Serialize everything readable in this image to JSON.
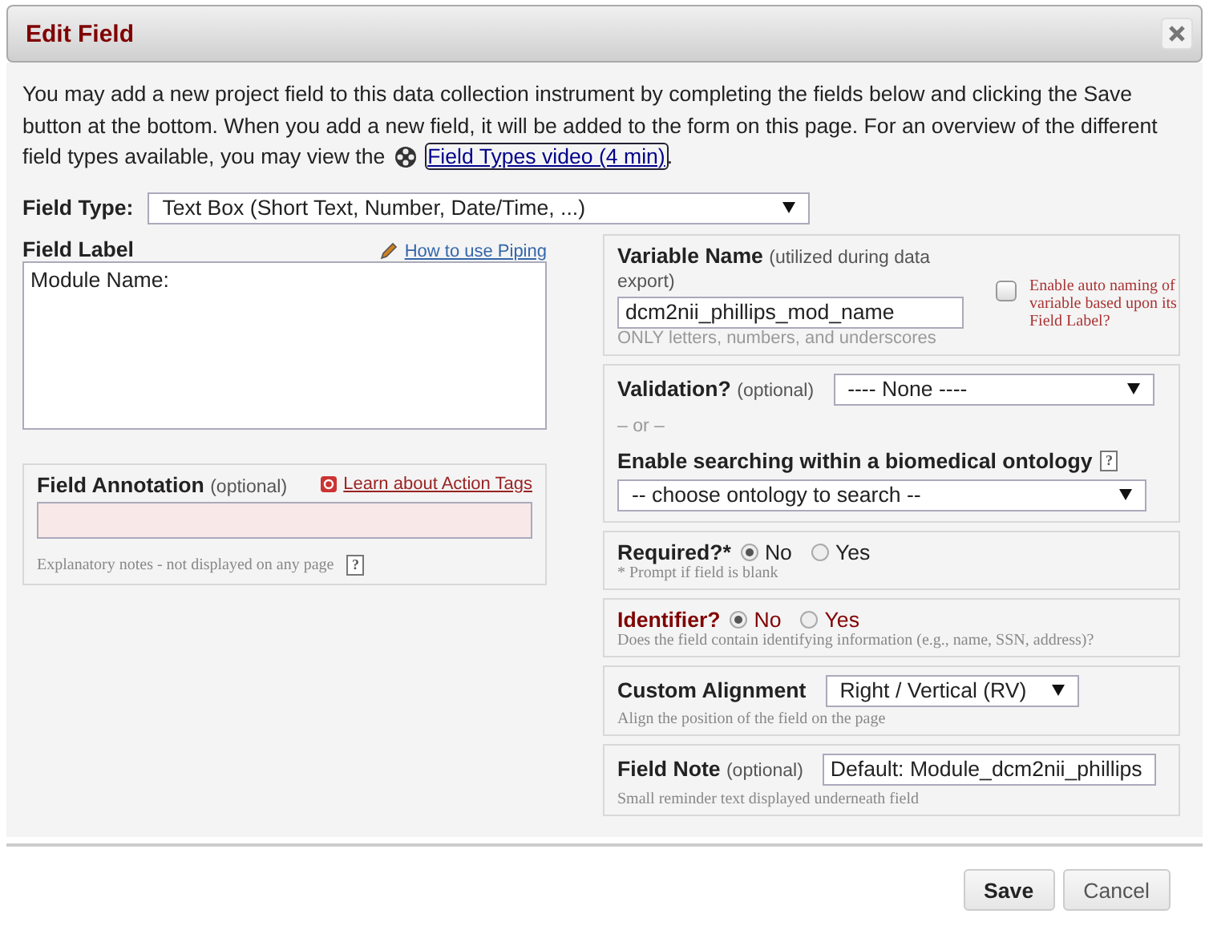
{
  "dialog": {
    "title": "Edit Field"
  },
  "intro": {
    "text": "You may add a new project field to this data collection instrument by completing the fields below and clicking the Save button at the bottom. When you add a new field, it will be added to the form on this page. For an overview of the different field types available, you may view the",
    "link": "Field Types video (4 min)",
    "after": "."
  },
  "field_type": {
    "label": "Field Type:",
    "value": "Text Box (Short Text, Number, Date/Time, ...)"
  },
  "field_label": {
    "label": "Field Label",
    "help_link": "How to use Piping",
    "value": "Module Name:"
  },
  "annotation": {
    "label": "Field Annotation",
    "optional": "(optional)",
    "link": "Learn about Action Tags",
    "note": "Explanatory notes - not displayed on any page",
    "help": "?"
  },
  "variable": {
    "label": "Variable Name",
    "hint": "(utilized during data export)",
    "value": "dcm2nii_phillips_mod_name",
    "note": "ONLY letters, numbers, and underscores",
    "auto_naming": {
      "label": "Enable auto naming of variable based upon its Field Label?",
      "checked": false
    }
  },
  "validation": {
    "label": "Validation?",
    "optional": "(optional)",
    "value": "---- None ----",
    "separator": "– or –",
    "ontology_label": "Enable searching within a biomedical ontology",
    "help": "?",
    "ontology_value": "-- choose ontology to search --"
  },
  "required": {
    "label": "Required?*",
    "options": [
      {
        "label": "No",
        "selected": true
      },
      {
        "label": "Yes",
        "selected": false
      }
    ],
    "note": "* Prompt if field is blank"
  },
  "identifier": {
    "label": "Identifier?",
    "options": [
      {
        "label": "No",
        "selected": true
      },
      {
        "label": "Yes",
        "selected": false
      }
    ],
    "note": "Does the field contain identifying information (e.g., name, SSN, address)?"
  },
  "alignment": {
    "label": "Custom Alignment",
    "value": "Right / Vertical (RV)",
    "note": "Align the position of the field on the page"
  },
  "field_note": {
    "label": "Field Note",
    "optional": "(optional)",
    "value": "Default: Module_dcm2nii_phillips",
    "note": "Small reminder text displayed underneath field"
  },
  "buttons": [
    {
      "label": "Save",
      "kind": "primary"
    },
    {
      "label": "Cancel",
      "kind": "secondary"
    }
  ]
}
